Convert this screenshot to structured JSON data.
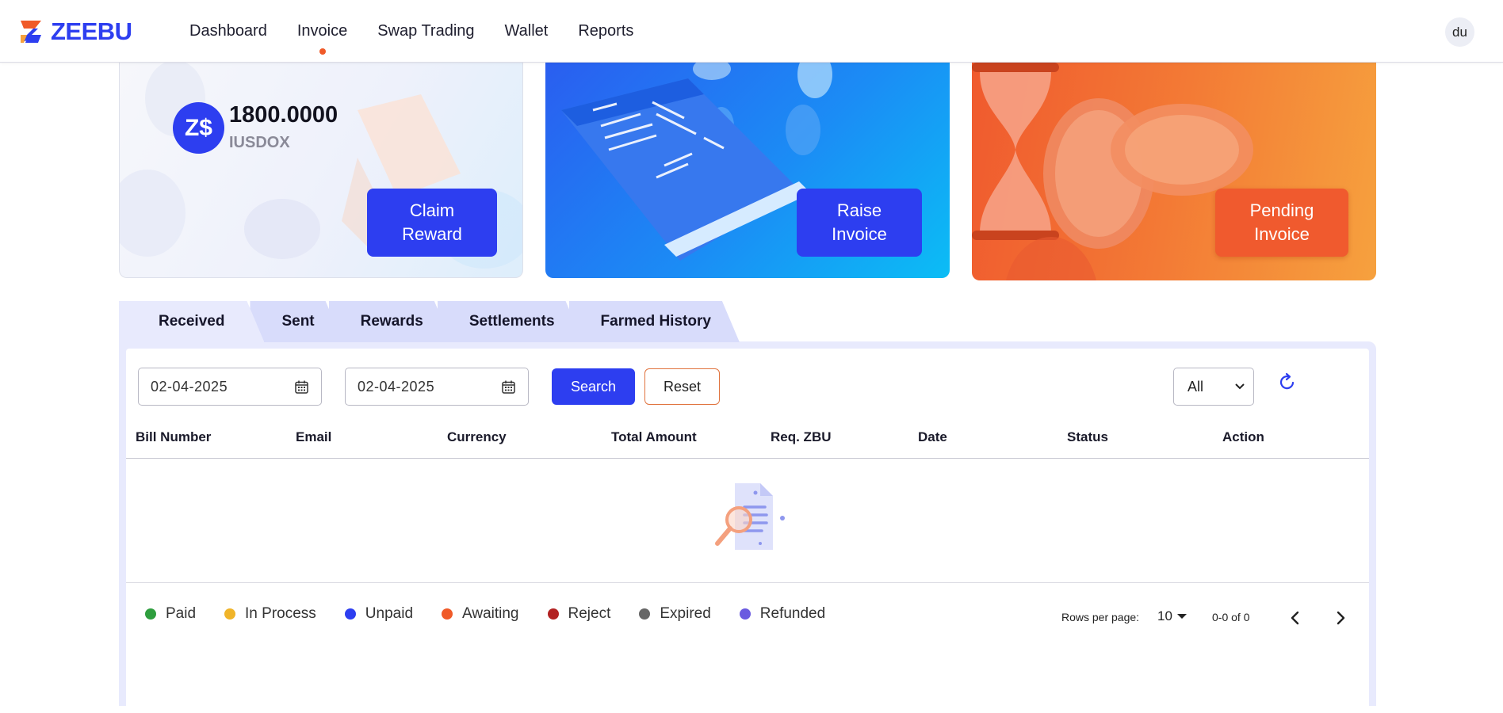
{
  "header": {
    "logo_text": "ZEEBU",
    "nav": [
      {
        "label": "Dashboard"
      },
      {
        "label": "Invoice"
      },
      {
        "label": "Swap Trading"
      },
      {
        "label": "Wallet"
      },
      {
        "label": "Reports"
      }
    ],
    "active_nav": "Invoice",
    "avatar_initials": "du"
  },
  "cards": {
    "reward": {
      "coin_symbol": "Z$",
      "balance": "1800.0000",
      "unit": "IUSDOX",
      "button_line1": "Claim",
      "button_line2": "Reward"
    },
    "raise": {
      "button_line1": "Raise",
      "button_line2": "Invoice"
    },
    "pending": {
      "button_line1": "Pending",
      "button_line2": "Invoice"
    }
  },
  "tabs": [
    {
      "label": "Received"
    },
    {
      "label": "Sent"
    },
    {
      "label": "Rewards"
    },
    {
      "label": "Settlements"
    },
    {
      "label": "Farmed History"
    }
  ],
  "active_tab": "Received",
  "filters": {
    "from_date": "02-04-2025",
    "to_date": "02-04-2025",
    "search_label": "Search",
    "reset_label": "Reset",
    "status_select": "All"
  },
  "table": {
    "columns": [
      "Bill Number",
      "Email",
      "Currency",
      "Total Amount",
      "Req. ZBU",
      "Date",
      "Status",
      "Action"
    ],
    "rows": []
  },
  "legend": [
    {
      "label": "Paid",
      "color": "#2e9e3e"
    },
    {
      "label": "In Process",
      "color": "#f0b429"
    },
    {
      "label": "Unpaid",
      "color": "#2d3ef0"
    },
    {
      "label": "Awaiting",
      "color": "#f05a28"
    },
    {
      "label": "Reject",
      "color": "#b22222"
    },
    {
      "label": "Expired",
      "color": "#666666"
    },
    {
      "label": "Refunded",
      "color": "#6a5ae0"
    }
  ],
  "pagination": {
    "rows_per_page_label": "Rows per page:",
    "rows_per_page": "10",
    "range": "0-0 of 0"
  },
  "colors": {
    "brand": "#2d3ef0",
    "accent": "#f05a28"
  }
}
